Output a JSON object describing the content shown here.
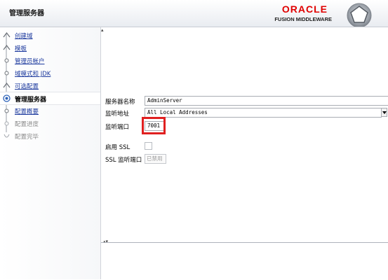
{
  "header": {
    "title": "管理服务器",
    "logo": {
      "oracle": "ORACLE",
      "fusion": "FUSION MIDDLEWARE"
    },
    "brand_color": "#e00000"
  },
  "sidebar": {
    "items": [
      {
        "label": "创建域",
        "state": "link",
        "icon": "done-step-icon"
      },
      {
        "label": "模板",
        "state": "link",
        "icon": "done-step-icon"
      },
      {
        "label": "管理员帐户",
        "state": "link",
        "icon": "step-icon"
      },
      {
        "label": "域模式和 JDK",
        "state": "link",
        "icon": "step-icon"
      },
      {
        "label": "可选配置",
        "state": "link",
        "icon": "done-step-icon"
      },
      {
        "label": "管理服务器",
        "state": "current",
        "icon": "current-step-icon"
      },
      {
        "label": "配置概要",
        "state": "link",
        "icon": "step-icon"
      },
      {
        "label": "配置进度",
        "state": "disabled",
        "icon": "pending-step-icon"
      },
      {
        "label": "配置完毕",
        "state": "disabled",
        "icon": "pending-step-icon"
      }
    ]
  },
  "form": {
    "server_name": {
      "label": "服务器名称",
      "value": "AdminServer"
    },
    "listen_address": {
      "label": "监听地址",
      "value": "All Local Addresses"
    },
    "listen_port": {
      "label": "监听端口",
      "value": "7001"
    },
    "enable_ssl": {
      "label": "启用 SSL",
      "checked": false
    },
    "ssl_port": {
      "label": "SSL 监听端口",
      "value": "已禁用"
    }
  },
  "colors": {
    "link": "#1d3a9e",
    "highlight": "#e02020"
  }
}
